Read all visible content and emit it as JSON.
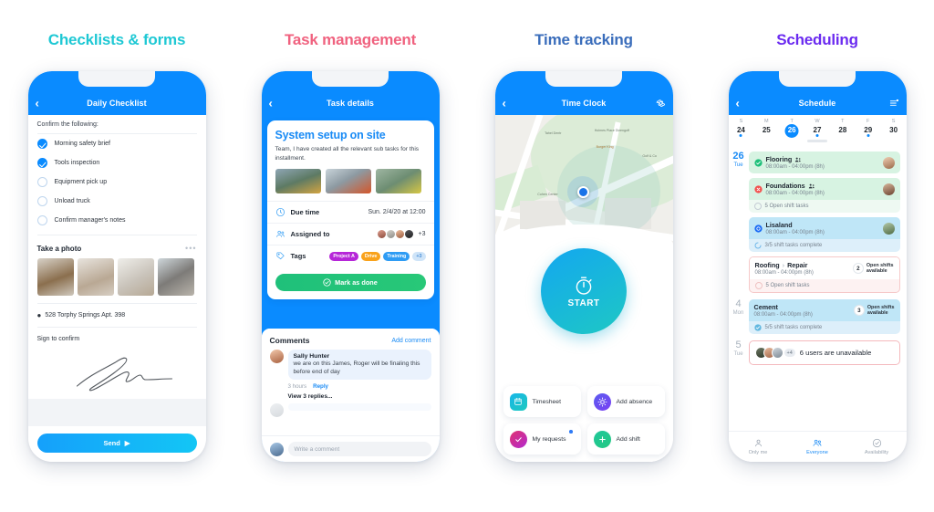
{
  "columns": [
    {
      "title": "Checklists & forms",
      "color": "#1ec8d4"
    },
    {
      "title": "Task management",
      "color": "#f0627f"
    },
    {
      "title": "Time tracking",
      "color": "#3a6dbb"
    },
    {
      "title": "Scheduling",
      "color": "#6b2bf0"
    }
  ],
  "checklist": {
    "nav_title": "Daily Checklist",
    "back_icon": "chevron-left-icon",
    "section_label": "Confirm the following:",
    "items": [
      {
        "label": "Morning safety brief",
        "checked": true
      },
      {
        "label": "Tools inspection",
        "checked": true
      },
      {
        "label": "Equipment pick up",
        "checked": false
      },
      {
        "label": "Unload truck",
        "checked": false
      },
      {
        "label": "Confirm manager's notes",
        "checked": false
      }
    ],
    "photo_label": "Take a photo",
    "photo_menu_icon": "more-horizontal-icon",
    "photo_count": 4,
    "address": "528 Torphy Springs Apt. 398",
    "address_icon": "location-pin-icon",
    "sign_label": "Sign to confirm",
    "send_label": "Send",
    "send_icon": "send-arrow-icon"
  },
  "task": {
    "nav_title": "Task details",
    "back_icon": "chevron-left-icon",
    "title": "System setup on site",
    "description": "Team, I have created all the relevant sub tasks for this installment.",
    "photo_count": 3,
    "rows": [
      {
        "icon": "clock-icon",
        "label": "Due time",
        "value": "Sun. 2/4/20 at 12:00"
      },
      {
        "icon": "users-icon",
        "label": "Assigned to",
        "value": "+3"
      },
      {
        "icon": "tag-icon",
        "label": "Tags",
        "value": ""
      }
    ],
    "tags": [
      {
        "label": "Project A",
        "color": "#b626d8"
      },
      {
        "label": "Drive",
        "color": "#f9a21b"
      },
      {
        "label": "Training",
        "color": "#2f9cf4"
      },
      {
        "label": "+3",
        "color": "#cfe4f8"
      }
    ],
    "done_label": "Mark as done",
    "done_icon": "check-circle-icon",
    "comments_title": "Comments",
    "add_comment_label": "Add comment",
    "comment": {
      "author": "Sally Hunter",
      "text": "we are on this James, Roger will be finaling this before end of day",
      "time": "3 hours",
      "reply_label": "Reply"
    },
    "view_replies": "View 3 replies...",
    "input_placeholder": "Write a comment"
  },
  "timeclock": {
    "nav_title": "Time Clock",
    "back_icon": "chevron-left-icon",
    "settings_icon": "gear-icon",
    "start_label": "START",
    "start_icon": "stopwatch-icon",
    "tiles": [
      {
        "label": "Timesheet",
        "icon": "calendar-icon",
        "color1": "#17b6e8",
        "color2": "#1ec9bf",
        "dot": false
      },
      {
        "label": "Add absence",
        "icon": "sun-icon",
        "color1": "#5b5cf0",
        "color2": "#7a40f2",
        "dot": false
      },
      {
        "label": "My requests",
        "icon": "check-icon",
        "color1": "#e0316f",
        "color2": "#b32ad0",
        "dot": true
      },
      {
        "label": "Add shift",
        "icon": "plus-icon",
        "color1": "#1fc79a",
        "color2": "#24c882",
        "dot": false
      }
    ]
  },
  "schedule": {
    "nav_title": "Schedule",
    "back_icon": "chevron-left-icon",
    "list_icon": "list-badge-icon",
    "weekdays": [
      "S",
      "M",
      "T",
      "W",
      "T",
      "F",
      "S"
    ],
    "dates": [
      {
        "num": "24",
        "selected": false,
        "mark": true
      },
      {
        "num": "25",
        "selected": false,
        "mark": false
      },
      {
        "num": "26",
        "selected": true,
        "mark": true
      },
      {
        "num": "27",
        "selected": false,
        "mark": true
      },
      {
        "num": "28",
        "selected": false,
        "mark": false
      },
      {
        "num": "29",
        "selected": false,
        "mark": true
      },
      {
        "num": "30",
        "selected": false,
        "mark": false
      }
    ],
    "days": [
      {
        "num": "26",
        "weekday": "Tue",
        "accent": "#1a8bf5",
        "shifts": [
          {
            "name": "Flooring",
            "time": "08:00am - 04:00pm (8h)",
            "status_icon": "check-circle-icon",
            "status_color": "#1fc07a",
            "team_icon": "users-icon",
            "bg": "#d9f5e3",
            "subbg": "#e9faf0",
            "avatar": true,
            "sub": "",
            "open_shifts": ""
          },
          {
            "name": "Foundations",
            "time": "08:00am - 04:00pm (8h)",
            "status_icon": "x-circle-icon",
            "status_color": "#f2524f",
            "team_icon": "users-icon",
            "bg": "#d9f5e3",
            "subbg": "#eef9f2",
            "avatar": true,
            "sub": "5 Open shift tasks",
            "open_shifts": ""
          },
          {
            "name": "Lisaland",
            "time": "08:00am - 04:00pm (8h)",
            "status_icon": "target-icon",
            "status_color": "#1a6bf5",
            "team_icon": "",
            "bg": "#bfe6f7",
            "subbg": "#ddeffa",
            "avatar": true,
            "sub": "3/5 shift tasks complete",
            "open_shifts": ""
          },
          {
            "name": "Roofing",
            "name2": "Repair",
            "time": "08:00am - 04:00pm (8h)",
            "status_icon": "",
            "status_color": "",
            "team_icon": "",
            "bg": "#ffffff",
            "subbg": "#fdf2f2",
            "avatar": false,
            "sub": "5 Open shift tasks",
            "open_shifts": "2",
            "open_text": "Open shifts available",
            "border": "#f6c9c9"
          }
        ]
      },
      {
        "num": "4",
        "weekday": "Mon",
        "accent": "#a8b2bd",
        "shifts": [
          {
            "name": "Cement",
            "time": "08:00am - 04:00pm (8h)",
            "status_icon": "",
            "status_color": "",
            "team_icon": "",
            "bg": "#bfe6f7",
            "subbg": "#ddeffa",
            "avatar": false,
            "sub": "5/5 shift tasks complete",
            "open_shifts": "3",
            "open_text": "Open shifts available"
          }
        ]
      },
      {
        "num": "5",
        "weekday": "Tue",
        "accent": "#a8b2bd",
        "unavailable": {
          "text": "6 users are unavailable",
          "count": "+4"
        }
      }
    ],
    "tabs": [
      {
        "label": "Only me",
        "icon": "person-icon",
        "active": false
      },
      {
        "label": "Everyone",
        "icon": "people-icon",
        "active": true
      },
      {
        "label": "Availability",
        "icon": "check-circle-icon",
        "active": false
      }
    ]
  }
}
